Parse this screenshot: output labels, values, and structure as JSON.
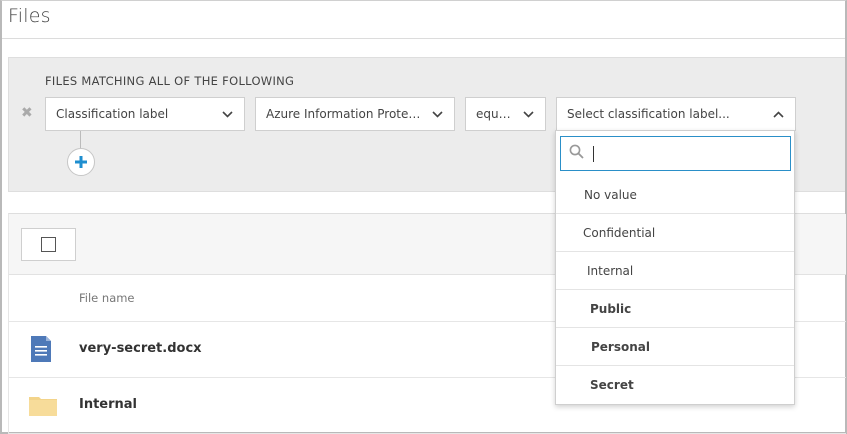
{
  "page": {
    "title": "Files"
  },
  "filter": {
    "heading": "FILES MATCHING ALL OF THE FOLLOWING",
    "remove_icon": "close-icon",
    "field": "Classification label",
    "provider": "Azure Information Protect...",
    "operator": "equals",
    "value_placeholder": "Select classification label..."
  },
  "dropdown": {
    "search_value": "",
    "options": [
      {
        "label": "No value",
        "bold": false
      },
      {
        "label": "Confidential",
        "bold": false
      },
      {
        "label": "Internal",
        "bold": false
      },
      {
        "label": "Public",
        "bold": true
      },
      {
        "label": "Personal",
        "bold": true
      },
      {
        "label": "Secret",
        "bold": true
      }
    ]
  },
  "table": {
    "column_file_name": "File name",
    "rows": [
      {
        "name": "very-secret.docx",
        "icon": "document-icon"
      },
      {
        "name": "Internal",
        "icon": "folder-icon"
      }
    ]
  },
  "colors": {
    "accent": "#2a8fc8",
    "add_plus": "#1e8ecf",
    "doc_icon": "#4e79b8",
    "folder_icon": "#f3d48a",
    "panel_bg": "#ececec"
  }
}
